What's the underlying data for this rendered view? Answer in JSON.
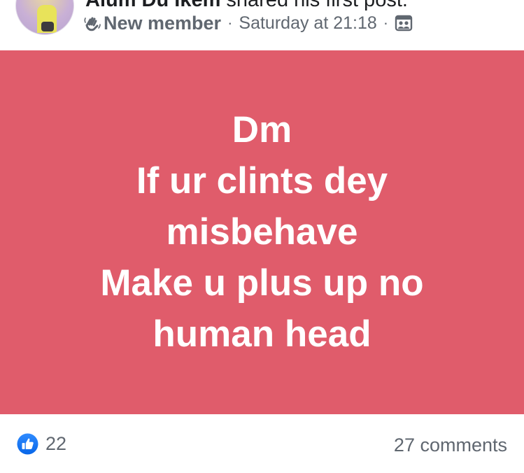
{
  "header": {
    "author_name": "Alum Du Ikem",
    "action_text": " shared his first post.",
    "badge_label": "New member",
    "separator": "·",
    "timestamp": "Saturday at 21:18",
    "badge_icon": "waving-hand-icon",
    "audience_icon": "group-audience-icon"
  },
  "post": {
    "background_color": "#e05c6b",
    "text_color": "#ffffff",
    "lines": [
      "Dm",
      "If ur clints dey",
      "misbehave",
      "Make u plus up no",
      "human head"
    ]
  },
  "footer": {
    "like_icon": "like-reaction-icon",
    "like_color": "#1877f2",
    "reaction_count": "22",
    "comment_count": "27 comments"
  }
}
